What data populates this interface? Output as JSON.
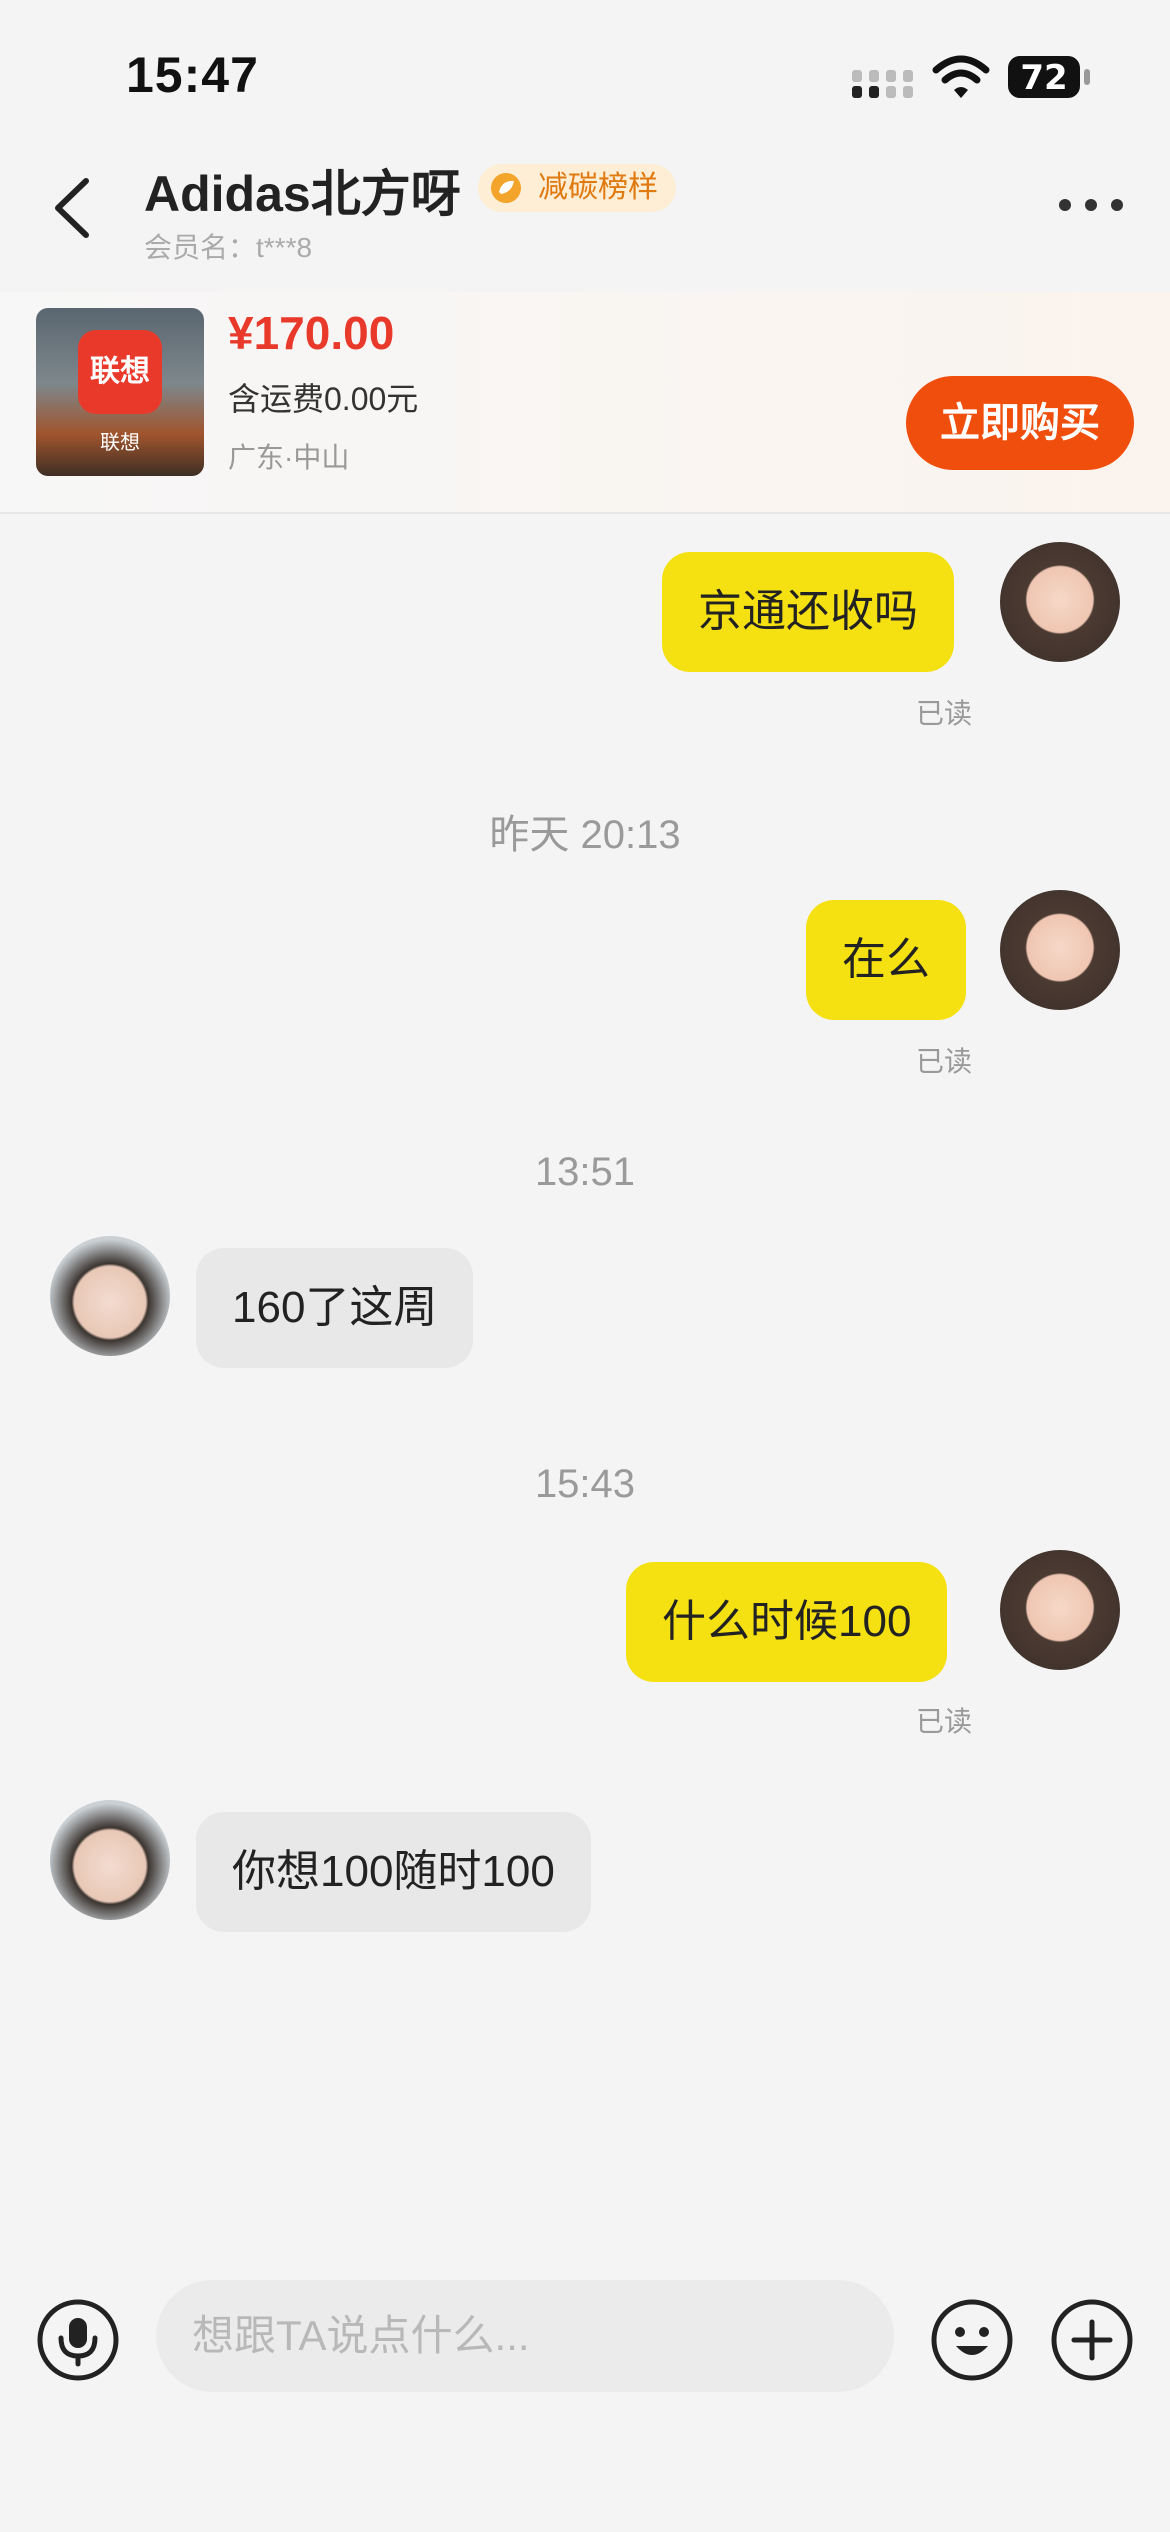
{
  "status": {
    "time": "15:47",
    "battery": "72"
  },
  "header": {
    "shop_name": "Adidas北方呀",
    "badge": "减碳榜样",
    "member": "会员名：t***8"
  },
  "product": {
    "thumb_logo": "联想",
    "thumb_caption": "联想",
    "price": "¥170.00",
    "shipping": "含运费0.00元",
    "location": "广东·中山",
    "buy_label": "立即购买"
  },
  "messages": {
    "m1": "京通还收吗",
    "m1_read": "已读",
    "t1": "昨天 20:13",
    "m2": "在么",
    "m2_read": "已读",
    "t2": "13:51",
    "m3": "160了这周",
    "t3": "15:43",
    "m4": "什么时候100",
    "m4_read": "已读",
    "m5": "你想100随时100"
  },
  "input": {
    "placeholder": "想跟TA说点什么..."
  },
  "icons": {
    "back": "back-icon",
    "more": "more-icon",
    "badge": "leaf-icon",
    "mic": "mic-icon",
    "emoji": "emoji-icon",
    "plus": "plus-icon"
  },
  "colors": {
    "self_bubble": "#f5e112",
    "other_bubble": "#e8e8e8",
    "price": "#e8392a",
    "buy_button": "#f04e0c",
    "badge_text": "#e07a10"
  }
}
